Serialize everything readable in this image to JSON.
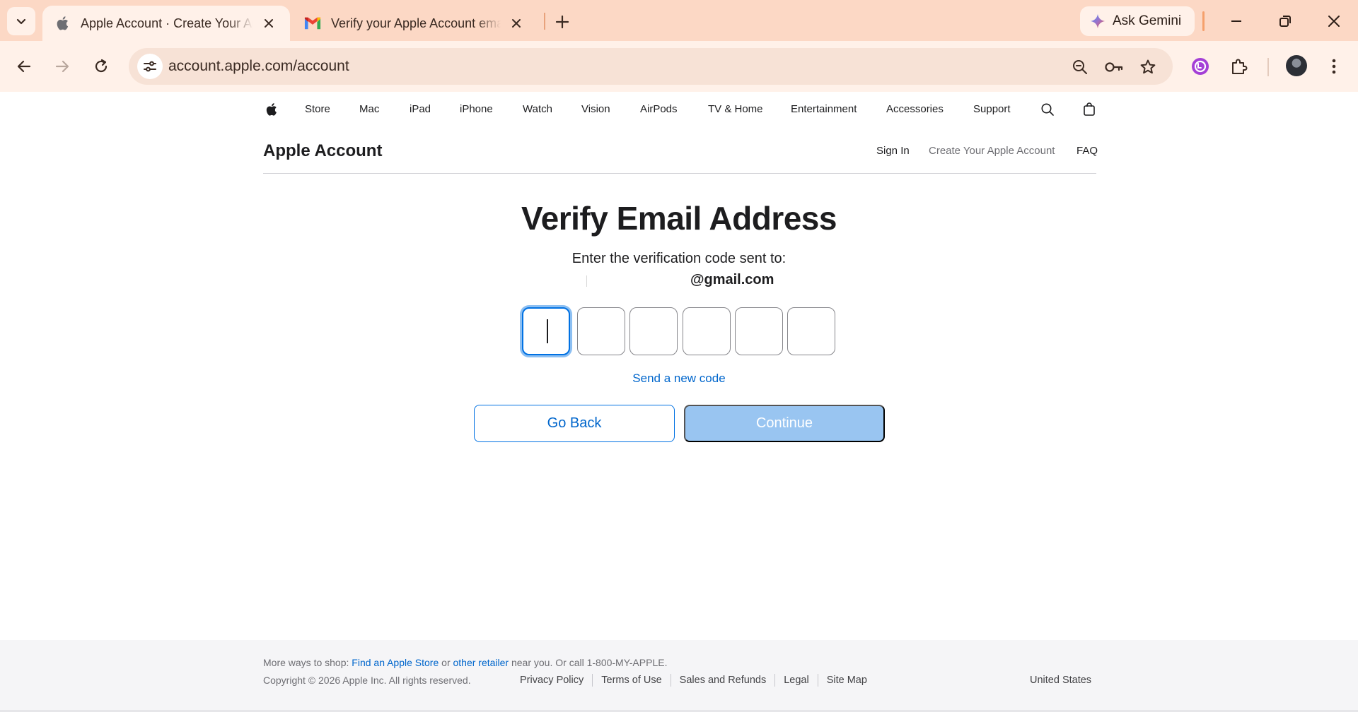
{
  "browser": {
    "tabs": [
      {
        "title": "Apple Account · Create Your Apple Account",
        "favicon": "apple-icon",
        "active": true
      },
      {
        "title": "Verify your Apple Account email address",
        "favicon": "gmail-icon",
        "active": false
      }
    ],
    "ask_gemini": "Ask Gemini",
    "url": "account.apple.com/account",
    "colors": {
      "tabstrip": "#fcd8c5",
      "toolbar": "#fff1e9",
      "omnibox": "#f7e2d6"
    }
  },
  "global_nav": {
    "items": [
      "Store",
      "Mac",
      "iPad",
      "iPhone",
      "Watch",
      "Vision",
      "AirPods",
      "TV & Home",
      "Entertainment",
      "Accessories",
      "Support"
    ]
  },
  "local_nav": {
    "title": "Apple Account",
    "links": [
      "Sign In",
      "Create Your Apple Account",
      "FAQ"
    ]
  },
  "verify": {
    "title": "Verify Email Address",
    "subtitle": "Enter the verification code sent to:",
    "email": "@gmail.com",
    "code_digits": [
      "",
      "",
      "",
      "",
      "",
      ""
    ],
    "send_new_code": "Send a new code",
    "go_back": "Go Back",
    "continue": "Continue",
    "colors": {
      "accent": "#0071e3",
      "link": "#0066cc",
      "continue_disabled": "#99c5f1"
    }
  },
  "footer": {
    "more_ways_prefix": "More ways to shop:",
    "find_store": "Find an Apple Store",
    "or": "or",
    "other_retailer": "other retailer",
    "near_you": "near you. Or call 1-800-MY-APPLE.",
    "copyright": "Copyright © 2026 Apple Inc. All rights reserved.",
    "links": [
      "Privacy Policy",
      "Terms of Use",
      "Sales and Refunds",
      "Legal",
      "Site Map"
    ],
    "country": "United States"
  }
}
